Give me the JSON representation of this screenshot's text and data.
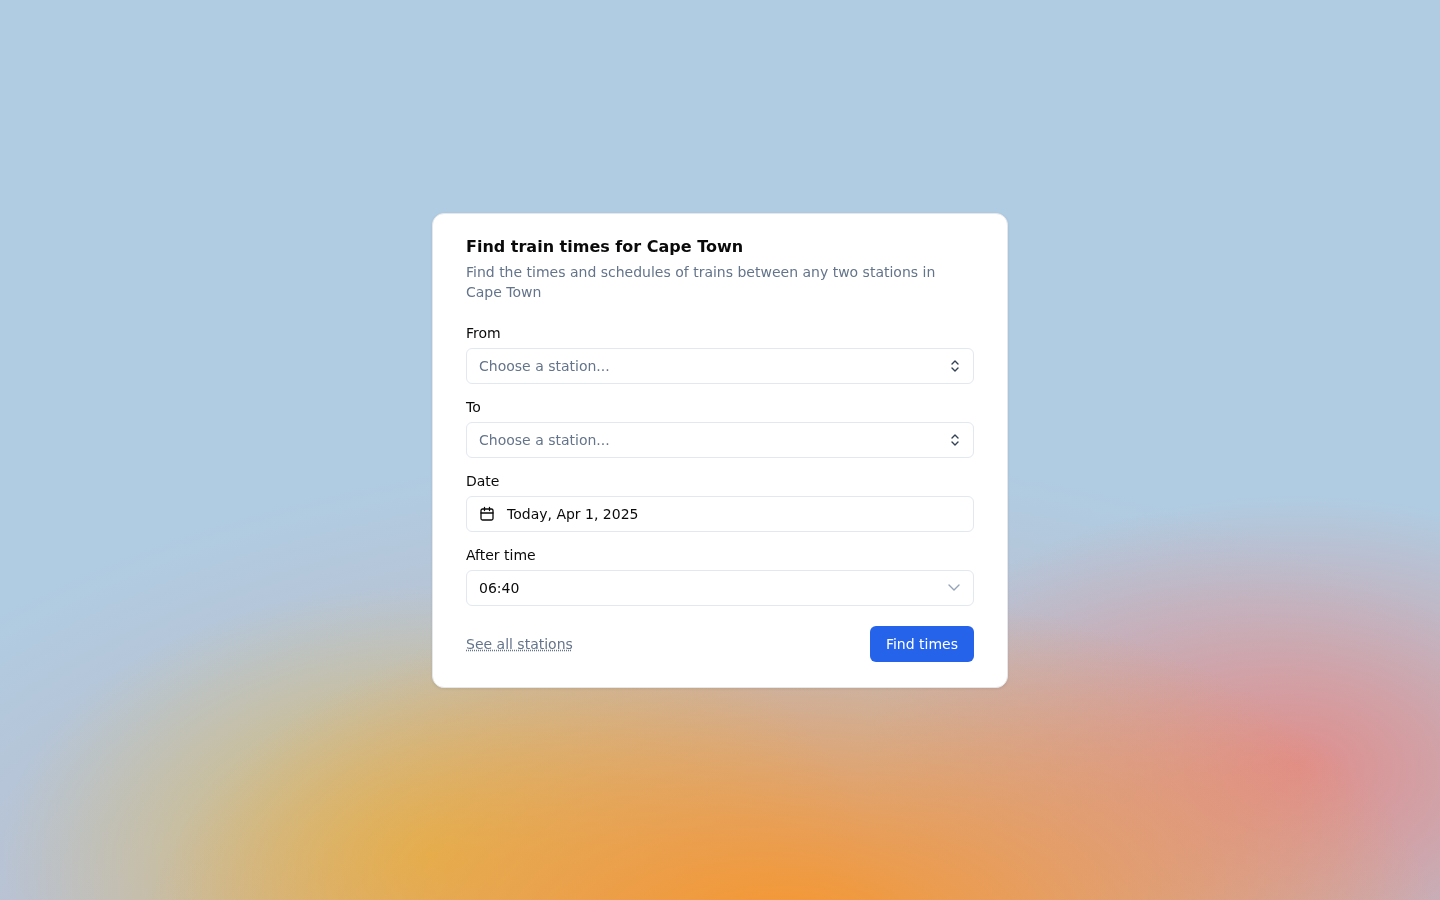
{
  "card": {
    "title": "Find train times for Cape Town",
    "description": "Find the times and schedules of trains between any two stations in Cape Town"
  },
  "fields": [
    {
      "kind": "combobox",
      "label": "From",
      "placeholder": "Choose a station..."
    },
    {
      "kind": "combobox",
      "label": "To",
      "placeholder": "Choose a station..."
    },
    {
      "kind": "date",
      "label": "Date",
      "value": "Today, Apr 1, 2025"
    },
    {
      "kind": "select",
      "label": "After time",
      "value": "06:40"
    }
  ],
  "link": "See all stations",
  "button": "Find times"
}
